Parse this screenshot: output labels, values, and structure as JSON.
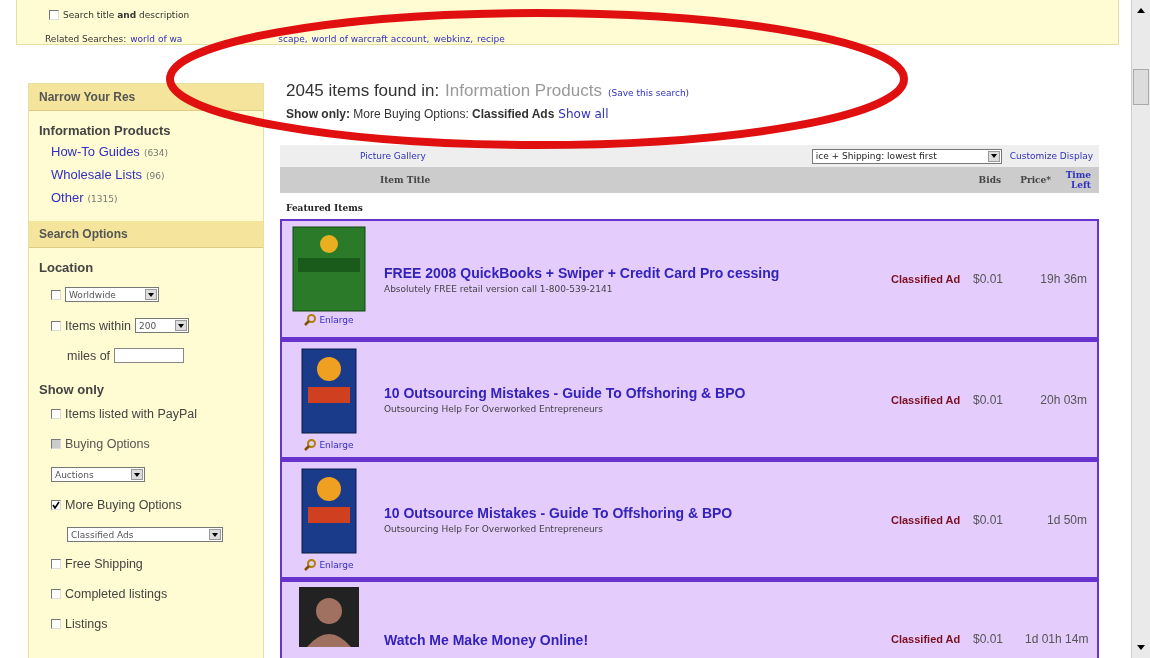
{
  "top_bar": {
    "title_search": {
      "label": "Search title **and** description",
      "checked": false
    },
    "related_label": "Related Searches:",
    "related_links": [
      "world of wa",
      "scape,",
      "world of warcraft account,",
      "webkinz,",
      "recipe"
    ]
  },
  "sidebar": {
    "narrow_title": "Narrow Your Res",
    "category": "Information Products",
    "categories": [
      {
        "name": "How-To Guides",
        "count": "(634)"
      },
      {
        "name": "Wholesale Lists",
        "count": "(96)"
      },
      {
        "name": "Other",
        "count": "(1315)"
      }
    ],
    "search_options_title": "Search Options",
    "location_title": "Location",
    "location_rows": [
      {
        "kind": "select",
        "checked": false,
        "value": "Worldwide"
      },
      {
        "kind": "select",
        "checked": false,
        "label": "Items within",
        "value": "200"
      },
      {
        "kind": "input",
        "label": "miles of"
      }
    ],
    "show_only_title": "Show only",
    "show_only": [
      {
        "kind": "checkbox",
        "label": "Items listed with PayPal",
        "checked": false,
        "disabled": false
      },
      {
        "kind": "checkbox",
        "label": "Buying Options",
        "checked": false,
        "disabled": true
      },
      {
        "kind": "select",
        "value": "Auctions"
      },
      {
        "kind": "checkbox",
        "label": "More Buying Options",
        "checked": true,
        "disabled": false
      },
      {
        "kind": "wide-select",
        "value": "Classified Ads"
      },
      {
        "kind": "checkbox",
        "label": "Free Shipping",
        "checked": false,
        "disabled": false
      },
      {
        "kind": "checkbox",
        "label": "Completed listings",
        "checked": false,
        "disabled": false
      },
      {
        "kind": "checkbox",
        "label": "Listings",
        "checked": false,
        "disabled": false
      }
    ]
  },
  "results": {
    "count_text": "2045 items found in:",
    "category": "Information Products",
    "save_link": "(Save this search)",
    "filter": "**Show only:** More Buying Options: **Classified Ads**",
    "show_all": "Show all",
    "view_tab": "Picture Gallery",
    "sort_value": "ice + Shipping: lowest first",
    "customize": "Customize Display",
    "columns": [
      "Item Title",
      "Bids",
      "Price*",
      "Time Left"
    ],
    "section": "Featured Items",
    "items": [
      {
        "kind": "software-box",
        "title": "FREE 2008 QuickBooks + Swiper + Credit Card Pro cessing",
        "subtitle": "Absolutely FREE retail version call 1-800-539-2141",
        "enlarge": "Enlarge",
        "format": "Classified Ad",
        "price": "$0.01",
        "time": "19h 36m"
      },
      {
        "kind": "ebook",
        "title": "10 Outsourcing Mistakes - Guide To Offshoring & BPO",
        "subtitle": "Outsourcing Help For Overworked Entrepreneurs",
        "enlarge": "Enlarge",
        "format": "Classified Ad",
        "price": "$0.01",
        "time": "20h 03m"
      },
      {
        "kind": "ebook",
        "title": "10 Outsource Mistakes - Guide To Offshoring & BPO",
        "subtitle": "Outsourcing Help For Overworked Entrepreneurs",
        "enlarge": "Enlarge",
        "format": "Classified Ad",
        "price": "$0.01",
        "time": "1d 50m"
      },
      {
        "kind": "person",
        "title": "Watch Me Make Money Online!",
        "format": "Classified Ad",
        "price": "$0.01",
        "time": "1d 01h 14m"
      }
    ]
  }
}
